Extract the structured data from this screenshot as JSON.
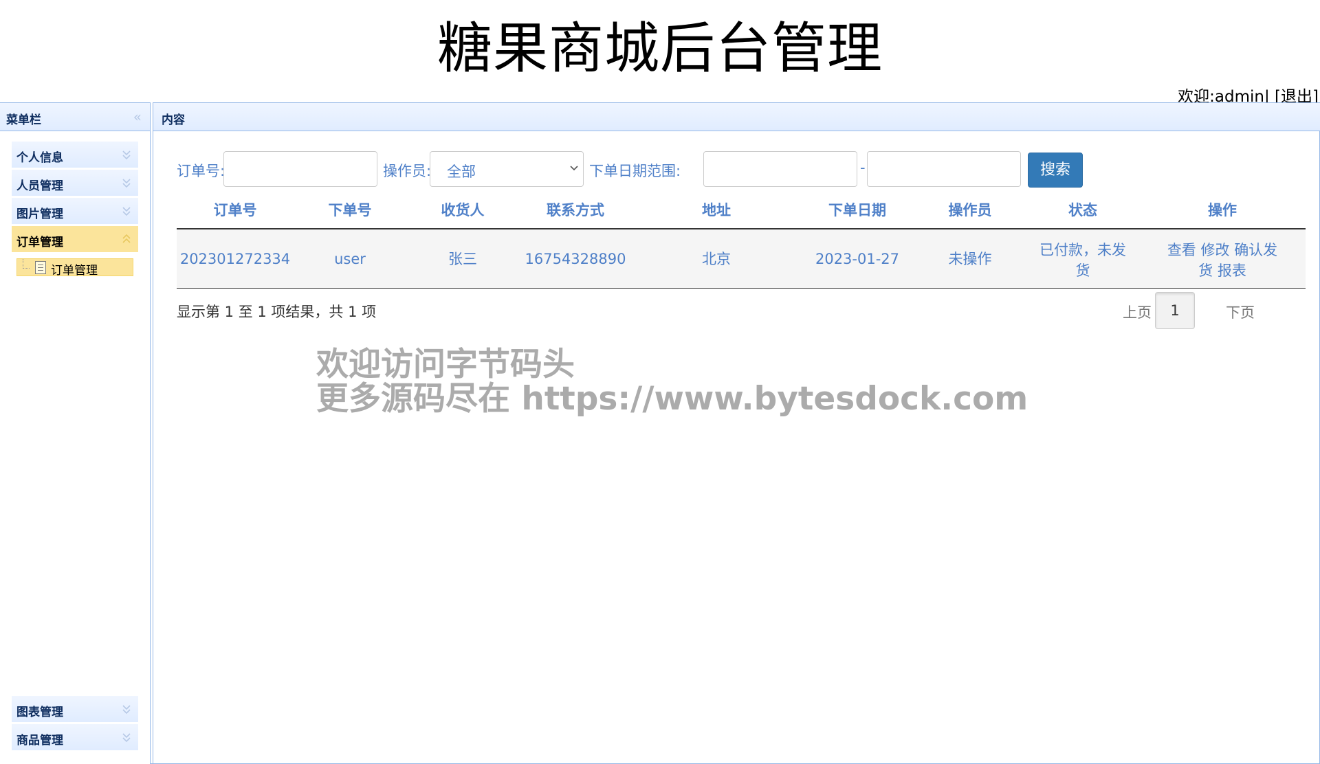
{
  "header": {
    "title": "糖果商城后台管理",
    "welcome": "欢迎:admin|",
    "logout": "[退出]"
  },
  "menu": {
    "title": "菜单栏",
    "items": [
      {
        "label": "个人信息"
      },
      {
        "label": "人员管理"
      },
      {
        "label": "图片管理"
      },
      {
        "label": "订单管理"
      },
      {
        "label": "图表管理"
      },
      {
        "label": "商品管理"
      }
    ],
    "active_index": 3,
    "sub_item": "订单管理"
  },
  "content": {
    "title": "内容",
    "search": {
      "order_no_label": "订单号:",
      "order_no_value": "",
      "operator_label": "操作员:",
      "operator_value": "全部",
      "date_range_label": "下单日期范围:",
      "date_from": "",
      "date_to": "",
      "dash": "-",
      "button": "搜索"
    },
    "table": {
      "headers": [
        "订单号",
        "下单号",
        "收货人",
        "联系方式",
        "地址",
        "下单日期",
        "操作员",
        "状态",
        "操作"
      ],
      "rows": [
        {
          "order_no": "202301272334",
          "user": "user",
          "receiver": "张三",
          "phone": "16754328890",
          "address": "北京",
          "date": "2023-01-27",
          "operator": "未操作",
          "status_line1": "已付款，未发",
          "status_line2": "货",
          "ops_line1": {
            "view": "查看",
            "edit": "修改",
            "confirm_a": "确认发"
          },
          "ops_line2": {
            "confirm_b": "货",
            "report": "报表"
          }
        }
      ]
    },
    "info": "显示第 1 至 1 项结果，共 1 项",
    "pager": {
      "prev": "上页",
      "current": "1",
      "next": "下页"
    }
  },
  "watermark": {
    "line1": "欢迎访问字节码头",
    "line2": "更多源码尽在  https://www.bytesdock.com"
  },
  "colors": {
    "accent": "#337ab7",
    "link": "#4f80c8",
    "panel_border": "#95b8e7",
    "active_menu": "#fbe49b"
  },
  "icons": [
    "collapse-left-icon",
    "chevron-down-icon",
    "chevron-up-icon",
    "page-icon",
    "select-caret-icon"
  ]
}
